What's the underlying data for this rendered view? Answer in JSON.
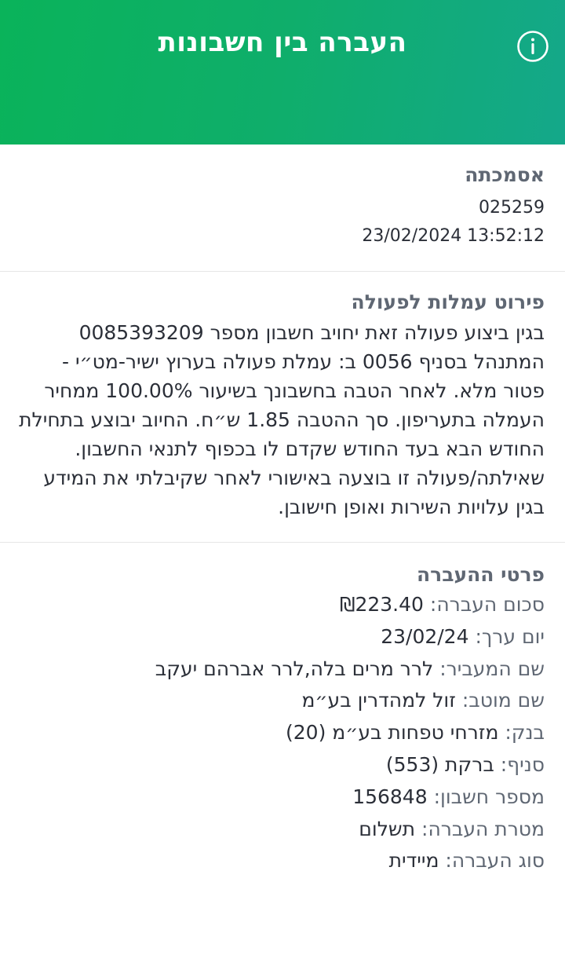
{
  "header": {
    "title": "העברה בין חשבונות"
  },
  "reference": {
    "title": "אסמכתה",
    "number": "025259",
    "datetime": "23/02/2024 13:52:12"
  },
  "fees": {
    "title": "פירוט עמלות לפעולה",
    "text": "בגין ביצוע פעולה זאת יחויב חשבון מספר 0085393209 המתנהל בסניף 0056 ב: עמלת פעולה בערוץ ישיר-מט״י - פטור מלא. לאחר הטבה בחשבונך בשיעור 100.00% ממחיר העמלה בתעריפון. סך ההטבה 1.85 ש״ח. החיוב יבוצע בתחילת החודש הבא בעד החודש שקדם לו בכפוף לתנאי החשבון. שאילתה/פעולה זו בוצעה באישורי לאחר שקיבלתי את המידע בגין עלויות השירות ואופן חישובן."
  },
  "details": {
    "title": "פרטי ההעברה",
    "rows": [
      {
        "label": "סכום העברה:",
        "value": "₪223.40"
      },
      {
        "label": "יום ערך:",
        "value": "23/02/24"
      },
      {
        "label": "שם המעביר:",
        "value": "לרר מרים בלה,לרר אברהם יעקב"
      },
      {
        "label": "שם מוטב:",
        "value": "זול למהדרין בע״מ"
      },
      {
        "label": "בנק:",
        "value": "מזרחי טפחות בע״מ (20)"
      },
      {
        "label": "סניף:",
        "value": "ברקת (553)"
      },
      {
        "label": "מספר חשבון:",
        "value": "156848"
      },
      {
        "label": "מטרת העברה:",
        "value": "תשלום"
      },
      {
        "label": "סוג העברה:",
        "value": "מיידית"
      }
    ]
  },
  "icons": {
    "info": "info-circle-icon"
  },
  "colors": {
    "header_gradient_start": "#0ab35a",
    "header_gradient_end": "#14a88a",
    "label_gray": "#5f6773",
    "text_dark": "#2b2f38"
  }
}
